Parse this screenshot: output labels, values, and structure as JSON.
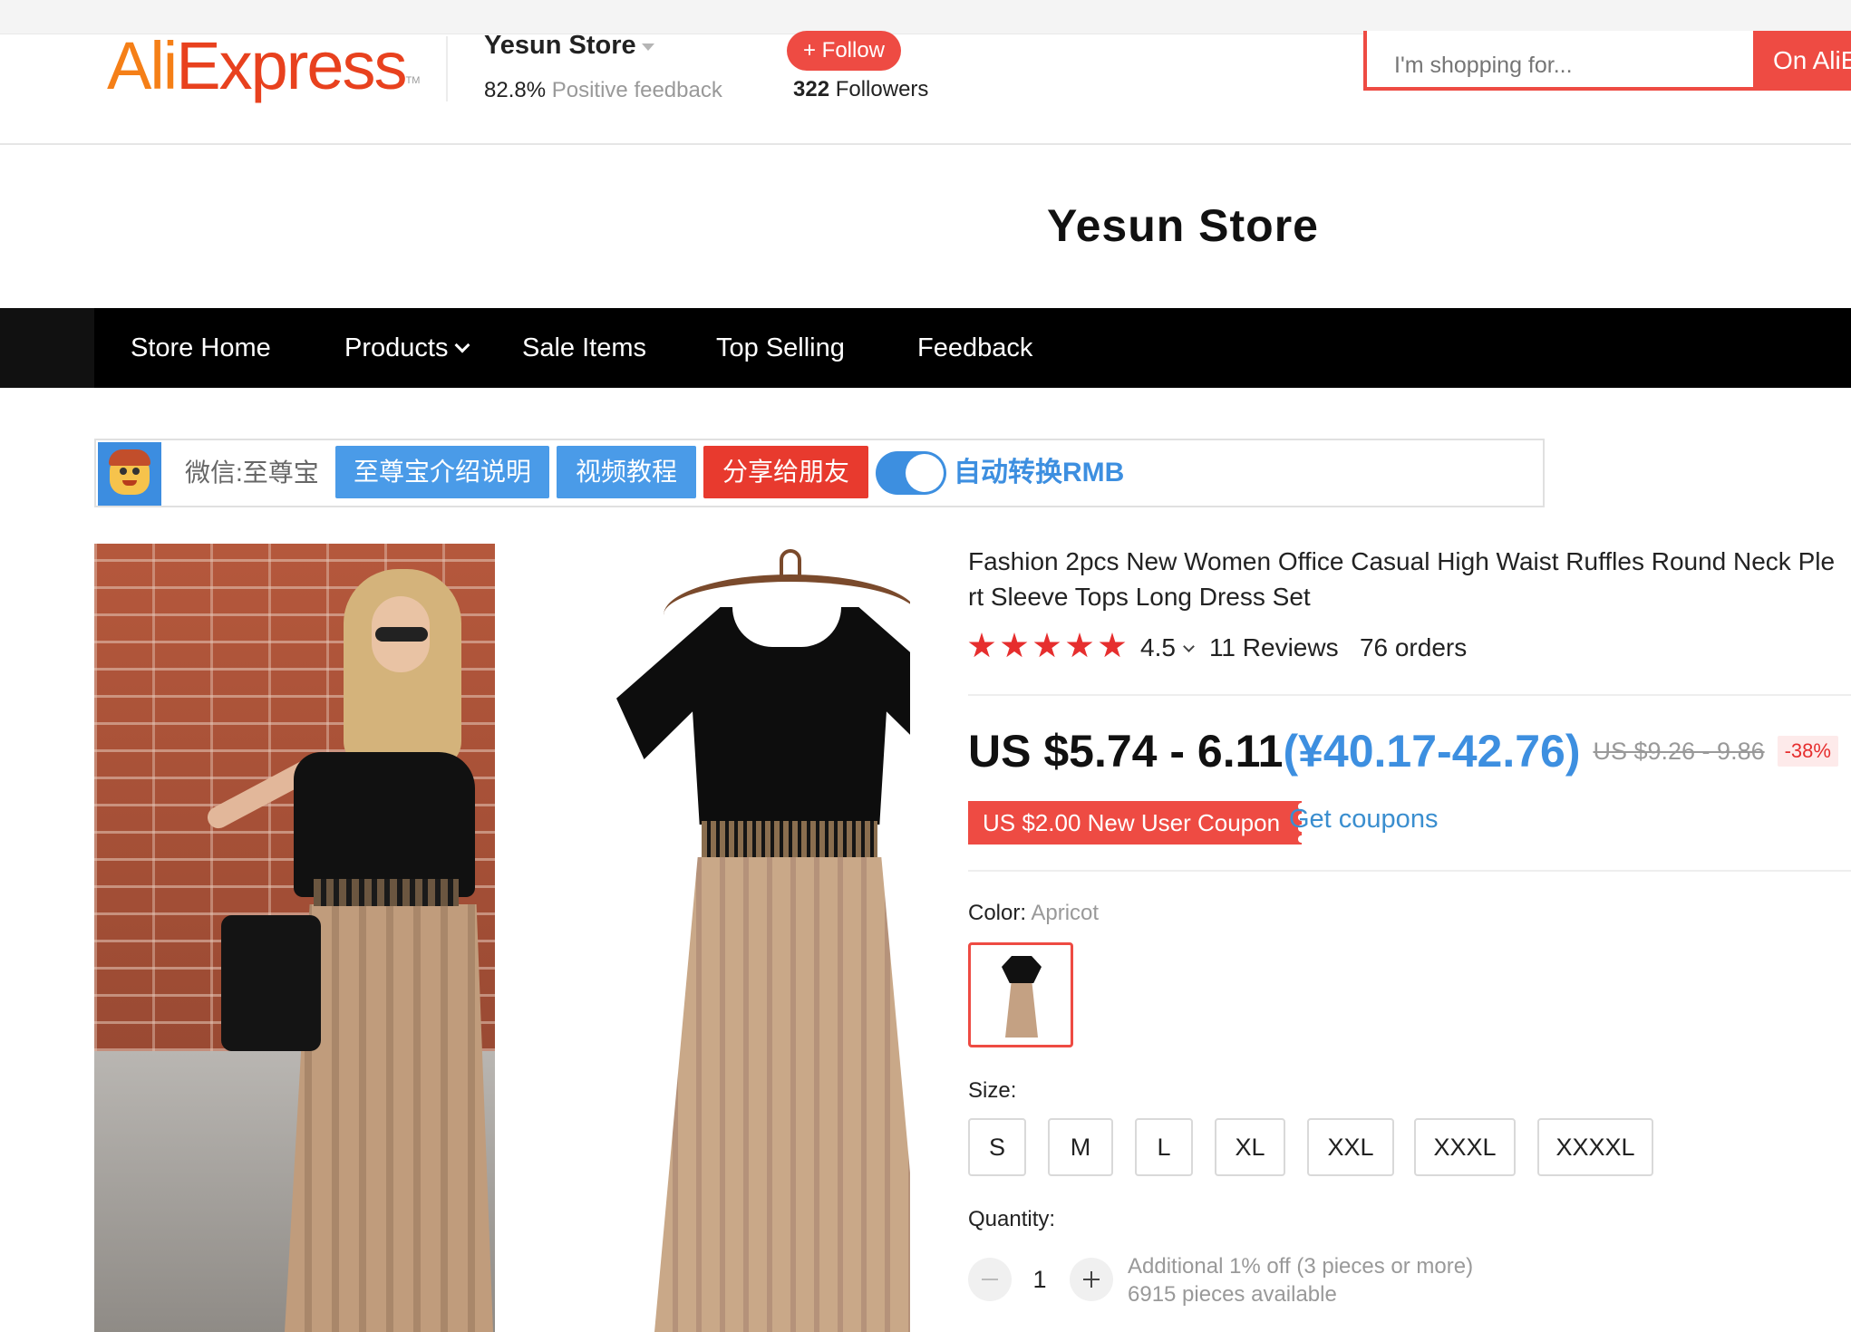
{
  "header": {
    "logo_ali": "Ali",
    "logo_express": "Express",
    "logo_tm": "TM",
    "store_name": "Yesun Store",
    "positive_pct": "82.8%",
    "positive_text": "Positive feedback",
    "follow_label": "+ Follow",
    "followers_count": "322",
    "followers_text": "Followers",
    "search_placeholder": "I'm shopping for...",
    "search_button_label": "On AliE"
  },
  "banner": {
    "title": "Yesun Store"
  },
  "nav": {
    "items": [
      {
        "label": "Store Home"
      },
      {
        "label": "Products"
      },
      {
        "label": "Sale Items"
      },
      {
        "label": "Top Selling"
      },
      {
        "label": "Feedback"
      }
    ]
  },
  "plugin": {
    "wechat_label": "微信:至尊宝",
    "intro_button": "至尊宝介绍说明",
    "video_button": "视频教程",
    "share_button": "分享给朋友",
    "toggle_label": "自动转换RMB",
    "toggle_on": true,
    "colors": {
      "blue": "#4a9be8",
      "red": "#e83a2e"
    }
  },
  "product": {
    "title_line1": "Fashion 2pcs New Women Office Casual High Waist Ruffles Round Neck Ple",
    "title_line2": "rt Sleeve Tops Long Dress Set",
    "rating": "4.5",
    "stars": 5,
    "reviews": "11 Reviews",
    "orders": "76 orders",
    "price_usd": "US $5.74 - 6.11",
    "price_cny": "(¥40.17-42.76)",
    "price_old": "US $9.26 - 9.86",
    "discount": "-38%",
    "coupon": "US $2.00 New User Coupon",
    "get_coupons": "Get coupons",
    "color_label": "Color:",
    "color_value": "Apricot",
    "size_label": "Size:",
    "sizes": [
      "S",
      "M",
      "L",
      "XL",
      "XXL",
      "XXXL",
      "XXXXL"
    ],
    "quantity_label": "Quantity:",
    "quantity_value": "1",
    "quantity_note1": "Additional 1% off (3 pieces or more)",
    "quantity_note2": "6915 pieces available"
  },
  "theme": {
    "accent": "#ee4b43",
    "link": "#3a8ecf",
    "price_cny": "#3d8fe0",
    "star": "#e62e2e"
  }
}
